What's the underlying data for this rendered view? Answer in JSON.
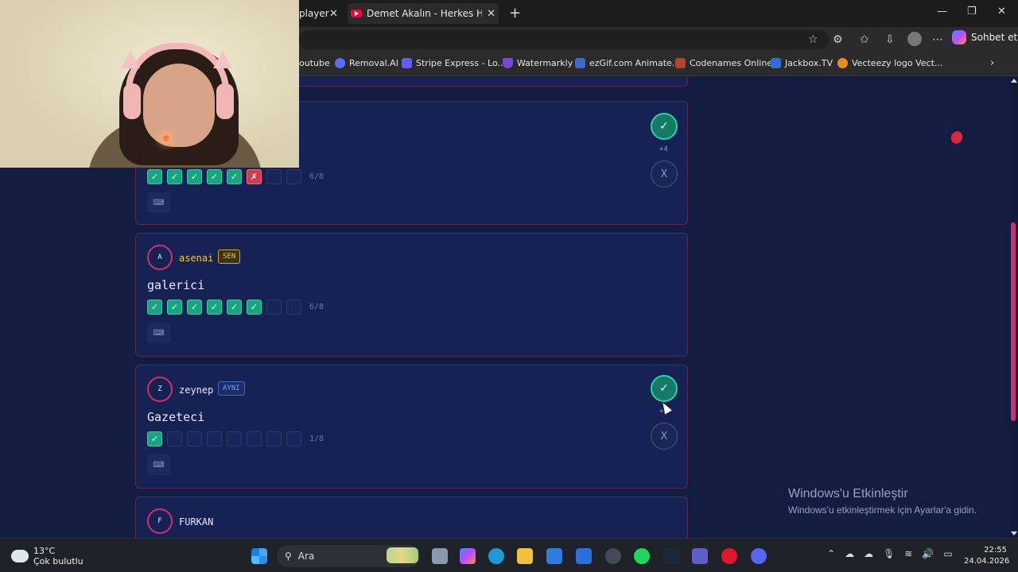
{
  "browser": {
    "tabs": [
      {
        "label": "player"
      },
      {
        "label": "Demet Akalın - Herkes Hak Ettiği G"
      }
    ],
    "new_tab": "+",
    "window_controls": {
      "minimize": "—",
      "maximize": "❐",
      "close": "✕"
    },
    "copilot_label": "Sohbet et",
    "bookmarks": [
      {
        "label": "outube",
        "color": "#2b2b2b"
      },
      {
        "label": "Removal.AI",
        "color": "#5a6cff"
      },
      {
        "label": "Stripe Express - Lo...",
        "color": "#635bff"
      },
      {
        "label": "Watermarkly",
        "color": "#6e4bd8"
      },
      {
        "label": "ezGif.com Animate...",
        "color": "#3a6bd1"
      },
      {
        "label": "Codenames Online",
        "color": "#b8422b"
      },
      {
        "label": "Jackbox.TV",
        "color": "#2a6fdb"
      },
      {
        "label": "Vecteezy logo Vect...",
        "color": "#f08a1a"
      }
    ]
  },
  "game": {
    "players": [
      {
        "initial": "",
        "name": "",
        "word": "",
        "marks": [
          "ok",
          "ok",
          "ok",
          "ok",
          "ok",
          "bad",
          "empty",
          "empty"
        ],
        "count": "6/8",
        "score": "+4",
        "has_votes": true
      },
      {
        "initial": "A",
        "name": "asenai",
        "name_color": "#f5c542",
        "badge": "SEN",
        "word": "galerici",
        "marks": [
          "ok",
          "ok",
          "ok",
          "ok",
          "ok",
          "ok",
          "empty",
          "empty"
        ],
        "count": "6/8",
        "has_votes": false
      },
      {
        "initial": "Z",
        "name": "zeynep",
        "name_color": "#e8e8ff",
        "badge": "AYNI",
        "word": "Gazeteci",
        "marks": [
          "ok",
          "empty",
          "empty",
          "empty",
          "empty",
          "empty",
          "empty",
          "empty"
        ],
        "count": "1/8",
        "score": "+1",
        "has_votes": true
      },
      {
        "initial": "F",
        "name": "FURKAN"
      }
    ],
    "vote_yes": "✓",
    "vote_no": "X",
    "keyboard_icon": "⌨"
  },
  "activation": {
    "title": "Windows'u Etkinleştir",
    "subtitle": "Windows'u etkinleştirmek için Ayarlar'a gidin."
  },
  "taskbar": {
    "weather_temp": "13°C",
    "weather_desc": "Çok bulutlu",
    "search_placeholder": "Ara",
    "time": "22:55",
    "date": "24.04.2026"
  },
  "colors": {
    "accent": "#d12f6a",
    "correct": "#16a57f",
    "wrong": "#d23a52",
    "page_bg": "#131d42"
  }
}
